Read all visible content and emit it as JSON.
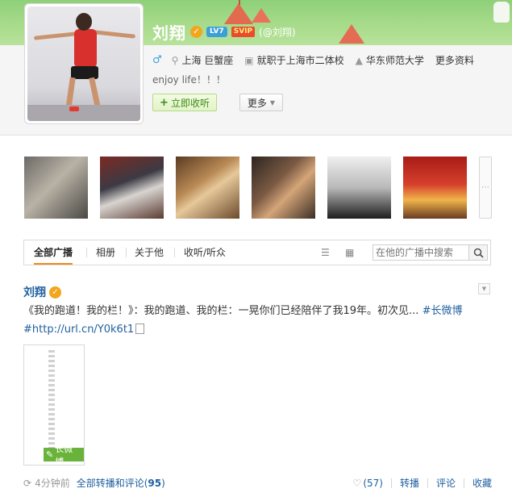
{
  "profile": {
    "name": "刘翔",
    "level": "LV7",
    "vip": "SVIP",
    "handle": "(@刘翔)",
    "location": "上海 巨蟹座",
    "job": "就职于上海市二体校",
    "school": "华东师范大学",
    "more_info": "更多资料",
    "bio": "enjoy life！！！",
    "follow_button": "立即收听",
    "more_button": "更多"
  },
  "tabs": {
    "all": "全部广播",
    "album": "相册",
    "about": "关于他",
    "listen": "收听/听众",
    "search_placeholder": "在他的广播中搜索"
  },
  "post": {
    "author": "刘翔",
    "text": "《我的跑道！我的栏！》：我的跑道、我的栏：一晃你们已经陪伴了我19年。初次见... ",
    "hashtag": "#长微博",
    "url": "#http://url.cn/Y0k6t1",
    "longweibo_label": "长微博",
    "time": "4分钟前",
    "all_reposts": "全部转播和评论",
    "repost_count": "95",
    "likes": "(57)",
    "repost": "转播",
    "comment": "评论",
    "favorite": "收藏"
  },
  "colors": {
    "link": "#1f5f9e",
    "banner": "#a9dc8c",
    "accent_tab": "#f08a24",
    "follow_green": "#3d8a1a"
  }
}
